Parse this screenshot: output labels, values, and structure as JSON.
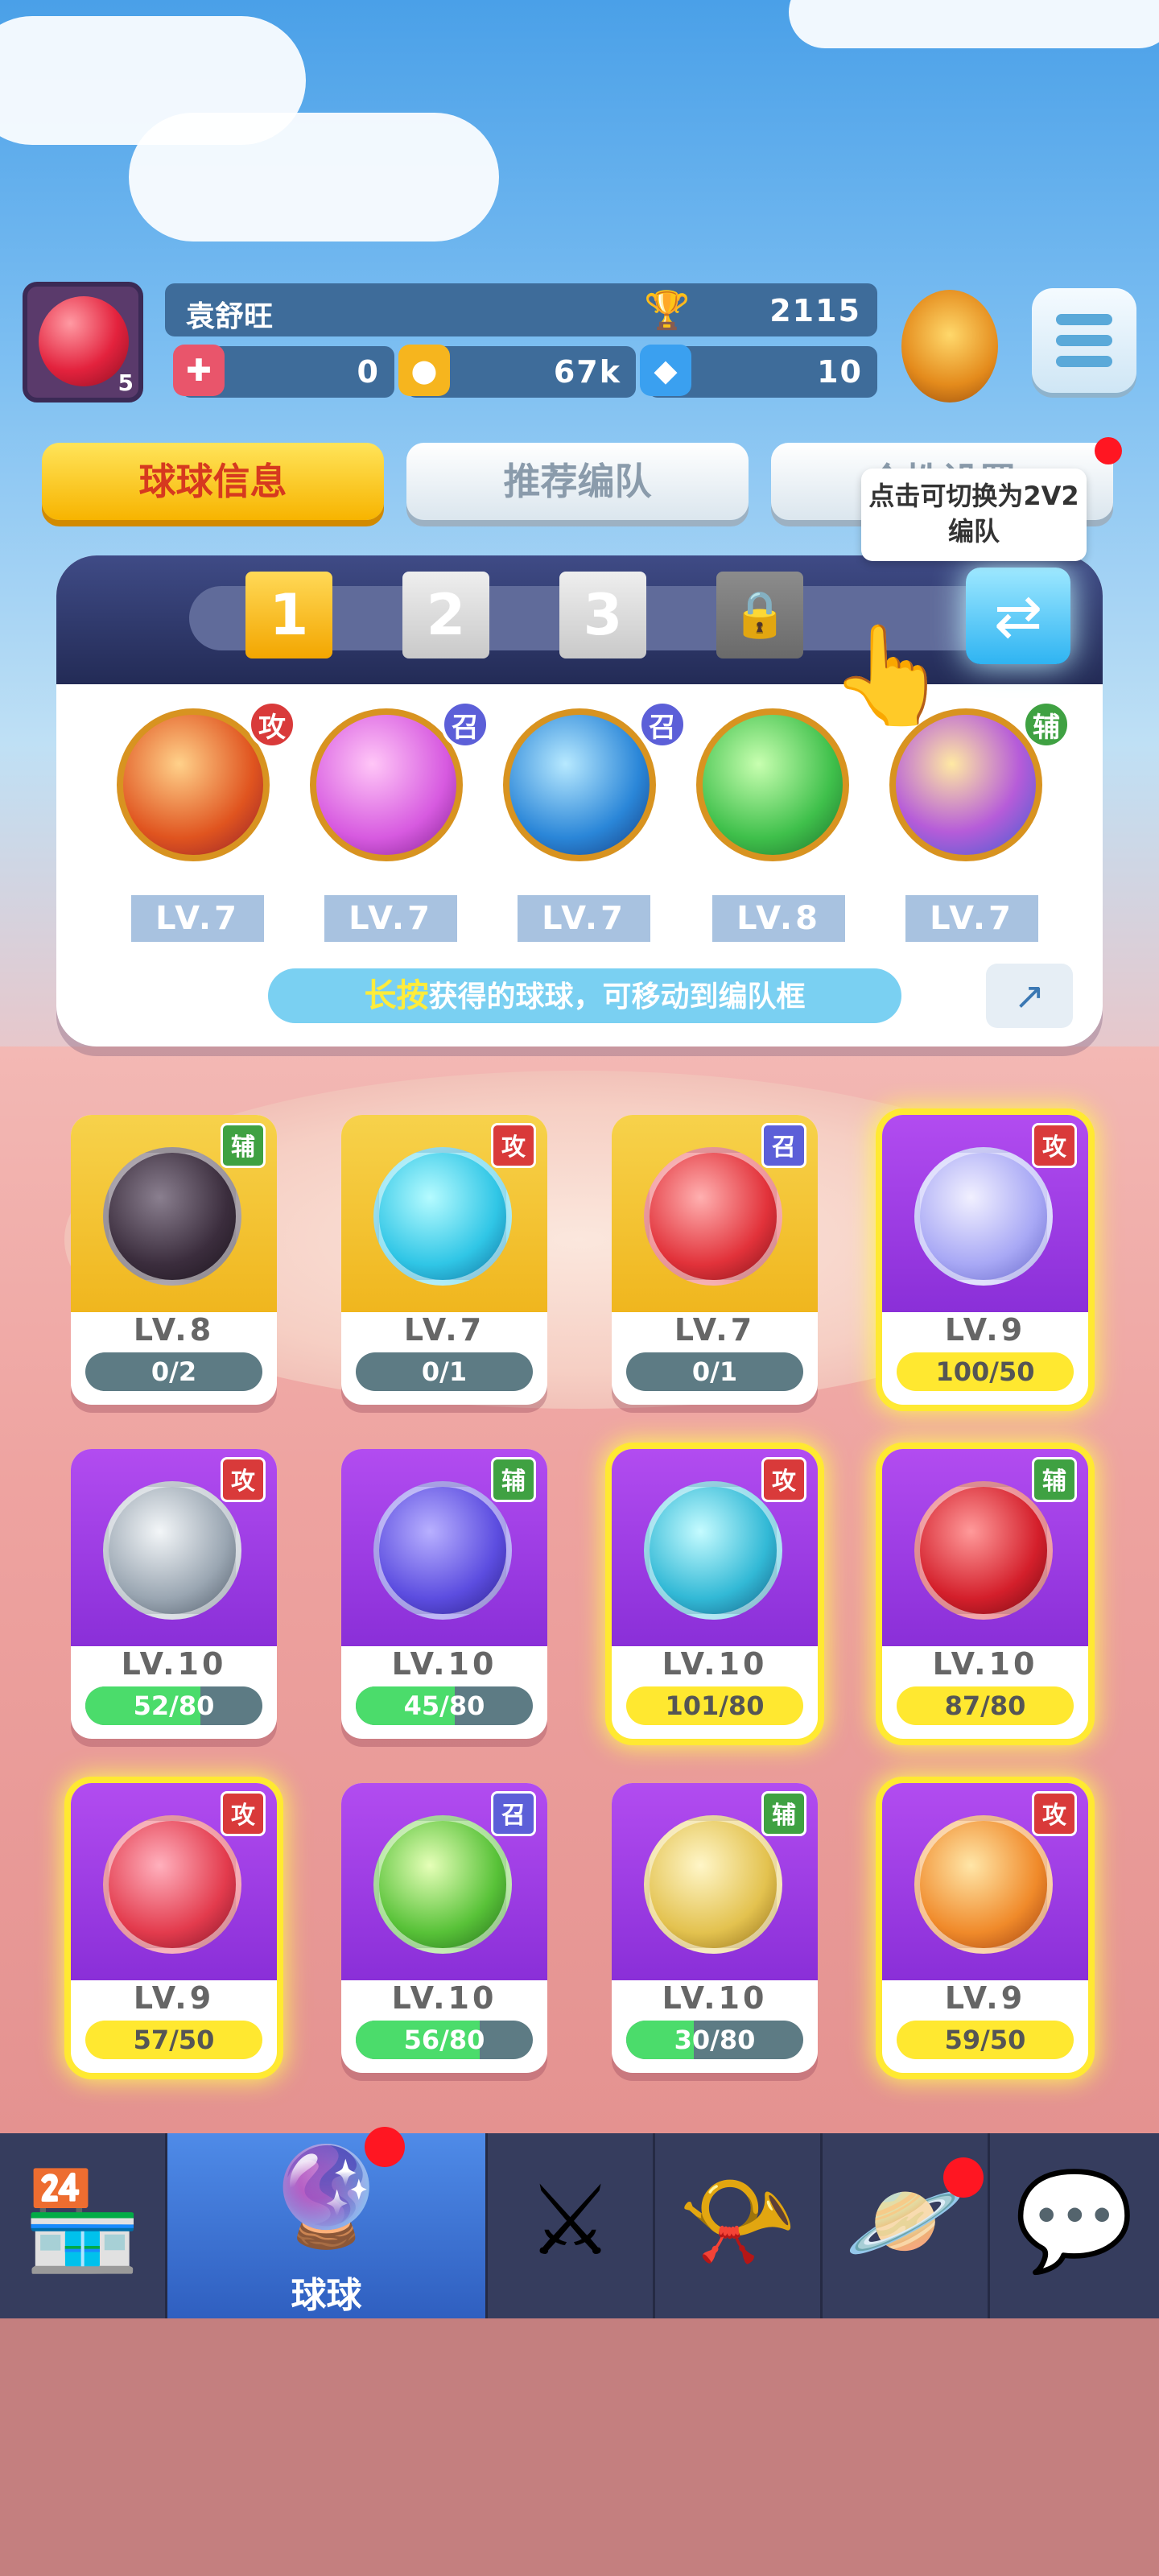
{
  "header": {
    "player_name": "袁舒旺",
    "avatar_level": "5",
    "trophies": "2115",
    "resource_1": "0",
    "resource_2": "67k",
    "resource_3": "10"
  },
  "tabs": [
    {
      "label": "球球信息",
      "active": true
    },
    {
      "label": "推荐编队",
      "active": false
    },
    {
      "label": "个性设置",
      "active": false,
      "badge": true
    }
  ],
  "team": {
    "slots": [
      "1",
      "2",
      "3",
      "locked",
      "locked"
    ],
    "active_slot": "1",
    "swap_tip": "点击可切换为2V2编队",
    "balls": [
      {
        "type": "攻",
        "level": "LV.7",
        "icon": "dragon-ball-icon"
      },
      {
        "type": "召",
        "level": "LV.7",
        "icon": "mushroom-ball-icon"
      },
      {
        "type": "召",
        "level": "LV.7",
        "icon": "ice-wall-ball-icon"
      },
      {
        "type": "辅",
        "level": "LV.8",
        "icon": "green-arrow-ball-icon"
      },
      {
        "type": "辅",
        "level": "LV.7",
        "icon": "crowd-ball-icon"
      }
    ],
    "hint_key": "长按",
    "hint_text": "获得的球球，可移动到编队框"
  },
  "cards": [
    {
      "type": "辅",
      "level": "LV.8",
      "progress": "0/2",
      "icon": "skull-ball-icon",
      "style": "gold",
      "state": "empty"
    },
    {
      "type": "攻",
      "level": "LV.7",
      "progress": "0/1",
      "icon": "ice-arrow-ball-icon",
      "style": "gold",
      "state": "empty"
    },
    {
      "type": "召",
      "level": "LV.7",
      "progress": "0/1",
      "icon": "cannon-ball-icon",
      "style": "gold",
      "state": "empty"
    },
    {
      "type": "攻",
      "level": "LV.9",
      "progress": "100/50",
      "icon": "bubble-ball-icon",
      "style": "purple",
      "state": "full"
    },
    {
      "type": "攻",
      "level": "LV.10",
      "progress": "52/80",
      "icon": "fan-ball-icon",
      "style": "purple",
      "state": "partial",
      "fill": 0.65
    },
    {
      "type": "辅",
      "level": "LV.10",
      "progress": "45/80",
      "icon": "swap-ball-icon",
      "style": "purple",
      "state": "partial",
      "fill": 0.56
    },
    {
      "type": "攻",
      "level": "LV.10",
      "progress": "101/80",
      "icon": "vortex-ball-icon",
      "style": "purple",
      "state": "full"
    },
    {
      "type": "辅",
      "level": "LV.10",
      "progress": "87/80",
      "icon": "fang-ball-icon",
      "style": "purple",
      "state": "full"
    },
    {
      "type": "攻",
      "level": "LV.9",
      "progress": "57/50",
      "icon": "lightning-ball-icon",
      "style": "purple",
      "state": "full"
    },
    {
      "type": "召",
      "level": "LV.10",
      "progress": "56/80",
      "icon": "radiation-ball-icon",
      "style": "purple",
      "state": "partial",
      "fill": 0.7
    },
    {
      "type": "辅",
      "level": "LV.10",
      "progress": "30/80",
      "icon": "pumpkin-ball-icon",
      "style": "purple",
      "state": "partial",
      "fill": 0.38
    },
    {
      "type": "攻",
      "level": "LV.9",
      "progress": "59/50",
      "icon": "sun-ball-icon",
      "style": "purple",
      "state": "full"
    }
  ],
  "nav": [
    {
      "label": "",
      "icon": "shop-icon"
    },
    {
      "label": "球球",
      "icon": "balls-icon",
      "active": true,
      "badge": true
    },
    {
      "label": "",
      "icon": "battle-swords-icon"
    },
    {
      "label": "",
      "icon": "whistle-icon"
    },
    {
      "label": "",
      "icon": "planet-icon",
      "badge": true
    },
    {
      "label": "",
      "icon": "social-chat-icon"
    }
  ]
}
